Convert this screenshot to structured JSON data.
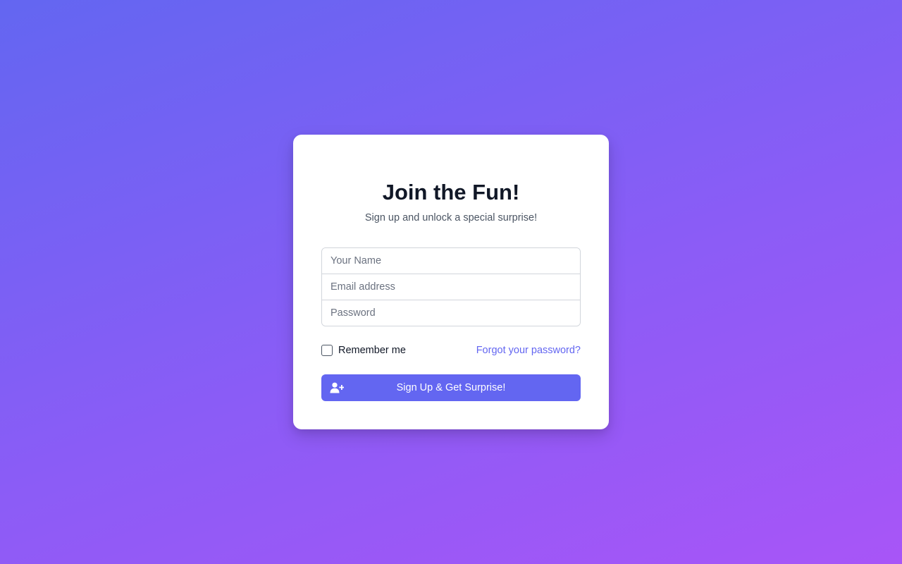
{
  "signup": {
    "title": "Join the Fun!",
    "subtitle": "Sign up and unlock a special surprise!",
    "fields": {
      "name_placeholder": "Your Name",
      "email_placeholder": "Email address",
      "password_placeholder": "Password",
      "name_value": "",
      "email_value": "",
      "password_value": ""
    },
    "remember_label": "Remember me",
    "remember_checked": false,
    "forgot_label": "Forgot your password?",
    "submit_label": "Sign Up & Get Surprise!",
    "submit_icon": "user-plus-icon"
  },
  "colors": {
    "accent": "#6366f1",
    "background_start": "#6366f1",
    "background_end": "#a855f7",
    "title": "#111827",
    "subtitle": "#4b5563"
  }
}
